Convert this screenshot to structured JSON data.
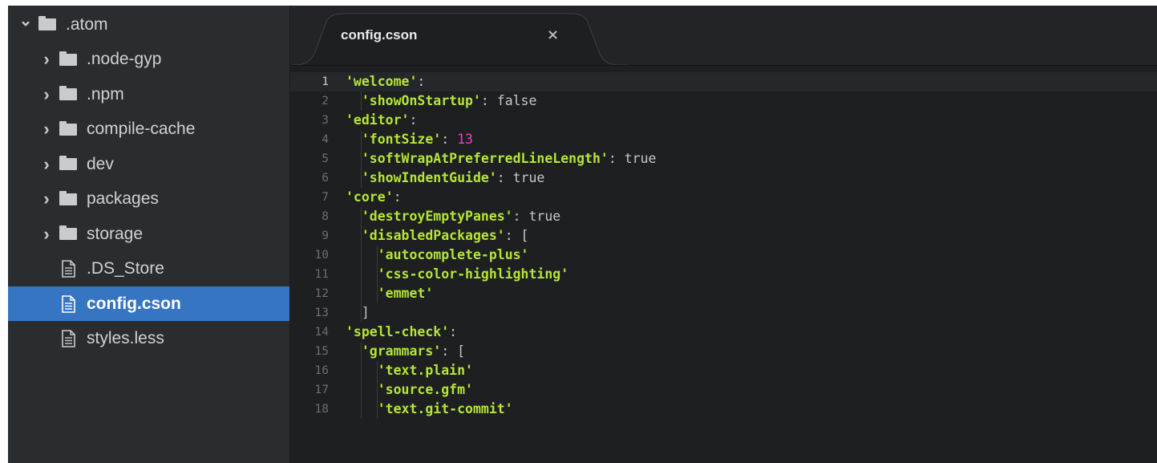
{
  "tree": {
    "items": [
      {
        "label": ".atom",
        "type": "folder",
        "expanded": true,
        "depth": 0
      },
      {
        "label": ".node-gyp",
        "type": "folder",
        "expanded": false,
        "depth": 1
      },
      {
        "label": ".npm",
        "type": "folder",
        "expanded": false,
        "depth": 1
      },
      {
        "label": "compile-cache",
        "type": "folder",
        "expanded": false,
        "depth": 1
      },
      {
        "label": "dev",
        "type": "folder",
        "expanded": false,
        "depth": 1
      },
      {
        "label": "packages",
        "type": "folder",
        "expanded": false,
        "depth": 1
      },
      {
        "label": "storage",
        "type": "folder",
        "expanded": false,
        "depth": 1
      },
      {
        "label": ".DS_Store",
        "type": "file",
        "depth": 1
      },
      {
        "label": "config.cson",
        "type": "file",
        "depth": 1,
        "selected": true
      },
      {
        "label": "styles.less",
        "type": "file",
        "depth": 1
      }
    ]
  },
  "tabs": [
    {
      "title": "config.cson",
      "active": true,
      "close_glyph": "×"
    }
  ],
  "editor": {
    "cursor_line": 1,
    "lines": [
      {
        "n": "1",
        "indent": 0,
        "tokens": [
          {
            "t": "'welcome'",
            "c": "str"
          },
          {
            "t": ":",
            "c": "kw"
          }
        ]
      },
      {
        "n": "2",
        "indent": 1,
        "tokens": [
          {
            "t": "'showOnStartup'",
            "c": "str"
          },
          {
            "t": ": false",
            "c": "kw"
          }
        ]
      },
      {
        "n": "3",
        "indent": 0,
        "tokens": [
          {
            "t": "'editor'",
            "c": "str"
          },
          {
            "t": ":",
            "c": "kw"
          }
        ]
      },
      {
        "n": "4",
        "indent": 1,
        "tokens": [
          {
            "t": "'fontSize'",
            "c": "str"
          },
          {
            "t": ": ",
            "c": "kw"
          },
          {
            "t": "13",
            "c": "num"
          }
        ]
      },
      {
        "n": "5",
        "indent": 1,
        "tokens": [
          {
            "t": "'softWrapAtPreferredLineLength'",
            "c": "str"
          },
          {
            "t": ": true",
            "c": "kw"
          }
        ]
      },
      {
        "n": "6",
        "indent": 1,
        "tokens": [
          {
            "t": "'showIndentGuide'",
            "c": "str"
          },
          {
            "t": ": true",
            "c": "kw"
          }
        ]
      },
      {
        "n": "7",
        "indent": 0,
        "tokens": [
          {
            "t": "'core'",
            "c": "str"
          },
          {
            "t": ":",
            "c": "kw"
          }
        ]
      },
      {
        "n": "8",
        "indent": 1,
        "tokens": [
          {
            "t": "'destroyEmptyPanes'",
            "c": "str"
          },
          {
            "t": ": true",
            "c": "kw"
          }
        ]
      },
      {
        "n": "9",
        "indent": 1,
        "tokens": [
          {
            "t": "'disabledPackages'",
            "c": "str"
          },
          {
            "t": ": [",
            "c": "kw"
          }
        ]
      },
      {
        "n": "10",
        "indent": 2,
        "tokens": [
          {
            "t": "'autocomplete-plus'",
            "c": "str"
          }
        ]
      },
      {
        "n": "11",
        "indent": 2,
        "tokens": [
          {
            "t": "'css-color-highlighting'",
            "c": "str"
          }
        ]
      },
      {
        "n": "12",
        "indent": 2,
        "tokens": [
          {
            "t": "'emmet'",
            "c": "str"
          }
        ]
      },
      {
        "n": "13",
        "indent": 1,
        "tokens": [
          {
            "t": "]",
            "c": "kw"
          }
        ]
      },
      {
        "n": "14",
        "indent": 0,
        "tokens": [
          {
            "t": "'spell-check'",
            "c": "str"
          },
          {
            "t": ":",
            "c": "kw"
          }
        ]
      },
      {
        "n": "15",
        "indent": 1,
        "tokens": [
          {
            "t": "'grammars'",
            "c": "str"
          },
          {
            "t": ": [",
            "c": "kw"
          }
        ]
      },
      {
        "n": "16",
        "indent": 2,
        "tokens": [
          {
            "t": "'text.plain'",
            "c": "str"
          }
        ]
      },
      {
        "n": "17",
        "indent": 2,
        "tokens": [
          {
            "t": "'source.gfm'",
            "c": "str"
          }
        ]
      },
      {
        "n": "18",
        "indent": 2,
        "tokens": [
          {
            "t": "'text.git-commit'",
            "c": "str"
          }
        ]
      }
    ]
  },
  "colors": {
    "editor_bg": "#1d1f21",
    "tree_bg": "#2a2d2f",
    "selection": "#3675c1",
    "string": "#b5e635",
    "number": "#f33ad4",
    "plain": "#c5c8c6"
  },
  "icons": {
    "expanded": "chevron-down-icon",
    "collapsed": "chevron-right-icon",
    "folder": "folder-icon",
    "file": "file-text-icon",
    "close": "close-icon"
  }
}
